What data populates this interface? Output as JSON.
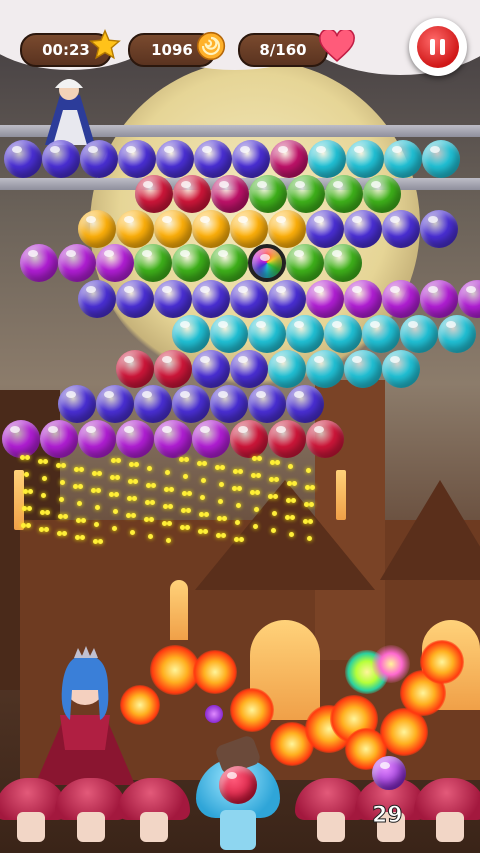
{
  "hud": {
    "timer": "00:23",
    "score": "1096",
    "progress": "8/160",
    "remaining_shots": "29",
    "pause_icon": "pause-icon"
  },
  "colors": {
    "blue": "#4a2fd6",
    "red": "#d0163a",
    "green": "#3fb31b",
    "yellow": "#ffb10a",
    "purple": "#b21ed6",
    "cyan": "#21c3d8",
    "pink_special": "#c0126a",
    "accent_pause": "#d01818"
  },
  "grid": {
    "rows": [
      [
        "blue",
        "blue",
        "blue",
        "blue",
        "blue",
        "blue",
        "blue",
        "pink_special",
        "cyan",
        "cyan",
        "cyan",
        "cyan"
      ],
      [
        "red",
        "red",
        "pink_special",
        "green",
        "green",
        "green",
        "green"
      ],
      [
        "yellow",
        "yellow",
        "yellow",
        "yellow",
        "yellow",
        "yellow",
        "blue",
        "blue",
        "blue",
        "blue"
      ],
      [
        "purple",
        "purple",
        "purple",
        "green",
        "green",
        "green",
        "rainbow",
        "green",
        "green"
      ],
      [
        "blue",
        "blue",
        "blue",
        "blue",
        "blue",
        "blue",
        "purple",
        "purple",
        "purple",
        "purple",
        "purple"
      ],
      [
        "cyan",
        "cyan",
        "cyan",
        "cyan",
        "cyan",
        "cyan",
        "cyan",
        "cyan"
      ],
      [
        "red",
        "red",
        "blue",
        "blue",
        "cyan",
        "cyan",
        "cyan",
        "cyan"
      ],
      [
        "blue",
        "blue",
        "blue",
        "blue",
        "blue",
        "blue",
        "blue"
      ],
      [
        "purple",
        "purple",
        "purple",
        "purple",
        "purple",
        "purple",
        "red",
        "red",
        "red"
      ]
    ]
  },
  "shooter": {
    "current_bubble": "red",
    "next_bubble": "purple"
  }
}
